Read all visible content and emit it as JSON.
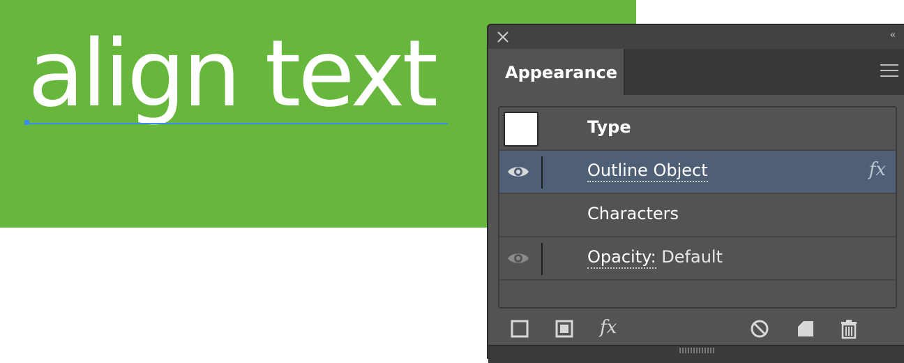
{
  "canvas": {
    "text": "align text",
    "background_color": "#66b73b",
    "text_color": "#ffffff",
    "baseline_color": "#3b8cf0"
  },
  "panel": {
    "tab_title": "Appearance",
    "rows": [
      {
        "label": "Type",
        "swatch_color": "#ffffff"
      },
      {
        "label": "Outline Object",
        "fx": "fx",
        "selected": true
      },
      {
        "label": "Characters"
      },
      {
        "label": "Opacity:",
        "value": "Default"
      }
    ],
    "toolbar_fx": "fx",
    "icons": [
      "close-icon",
      "collapse-icon",
      "panel-menu-icon",
      "eye-icon",
      "fx-icon",
      "add-new-stroke-icon",
      "add-new-fill-icon",
      "add-effect-icon",
      "clear-appearance-icon",
      "duplicate-item-icon",
      "delete-icon"
    ]
  }
}
